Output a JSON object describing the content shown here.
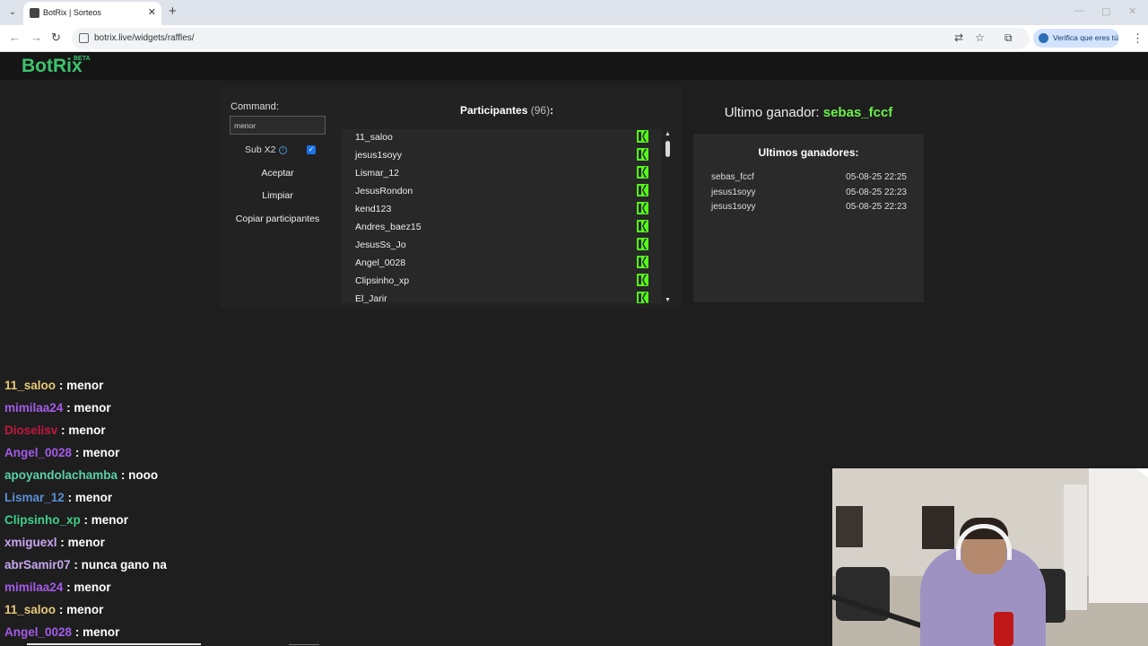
{
  "browser": {
    "tab_title": "BotRix | Sorteos",
    "tab_close": "✕",
    "new_tab": "+",
    "url": "botrix.live/widgets/raffles/",
    "verify_label": "Verifica que eres tú",
    "icons": [
      "back-icon",
      "forward-icon",
      "reload-icon",
      "site-info-icon",
      "translate-icon",
      "star-icon",
      "extensions-icon",
      "menu-icon"
    ]
  },
  "site": {
    "logo": "BotRix",
    "logo_badge": "BETA",
    "accent": "#3ec46d"
  },
  "raffle": {
    "command_label": "Command:",
    "command_value": "menor",
    "sub_label": "Sub X2",
    "sub_checked": true,
    "buttons": {
      "accept": "Aceptar",
      "clear": "Limpiar",
      "copy": "Copiar participantes"
    },
    "participants_title": "Participantes",
    "participants_count": "(96)",
    "participants_colon": ":",
    "participants": [
      "11_saloo",
      "jesus1soyy",
      "Lismar_12",
      "JesusRondon",
      "kend123",
      "Andres_baez15",
      "JesusSs_Jo",
      "Angel_0028",
      "Clipsinho_xp",
      "El_Jarir"
    ]
  },
  "winners": {
    "last_winner_label": "Ultimo ganador:",
    "last_winner": "sebas_fccf",
    "history_title": "Ultimos ganadores:",
    "history": [
      {
        "name": "sebas_fccf",
        "date": "05-08-25 22:25"
      },
      {
        "name": "jesus1soyy",
        "date": "05-08-25 22:23"
      },
      {
        "name": "jesus1soyy",
        "date": "05-08-25 22:23"
      }
    ]
  },
  "chat": [
    {
      "user": "11_saloo",
      "color": "#e8c97a",
      "text": "menor"
    },
    {
      "user": "mimilaa24",
      "color": "#a45be8",
      "text": "menor"
    },
    {
      "user": "Dioselisv",
      "color": "#c2183e",
      "text": "menor"
    },
    {
      "user": "Angel_0028",
      "color": "#a45be8",
      "text": "menor"
    },
    {
      "user": "apoyandolachamba",
      "color": "#5ad0a8",
      "text": "nooo"
    },
    {
      "user": "Lismar_12",
      "color": "#5b8fd6",
      "text": "menor"
    },
    {
      "user": "Clipsinho_xp",
      "color": "#3ed08a",
      "text": "menor"
    },
    {
      "user": "xmiguexl",
      "color": "#c7a6f0",
      "text": "menor"
    },
    {
      "user": "abrSamir07",
      "color": "#c7a6f0",
      "text": "nunca gano na"
    },
    {
      "user": "mimilaa24",
      "color": "#a45be8",
      "text": "menor"
    },
    {
      "user": "11_saloo",
      "color": "#e8c97a",
      "text": "menor"
    },
    {
      "user": "Angel_0028",
      "color": "#a45be8",
      "text": "menor"
    }
  ]
}
